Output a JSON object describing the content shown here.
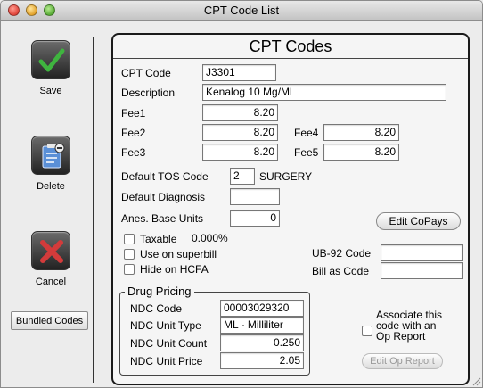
{
  "window": {
    "title": "CPT Code List"
  },
  "toolbar": {
    "save_label": "Save",
    "delete_label": "Delete",
    "cancel_label": "Cancel",
    "bundled_label": "Bundled Codes"
  },
  "panel": {
    "title": "CPT Codes"
  },
  "form": {
    "cpt_code_label": "CPT Code",
    "cpt_code": "J3301",
    "description_label": "Description",
    "description": "Kenalog 10 Mg/Ml",
    "fee1_label": "Fee1",
    "fee1": "8.20",
    "fee2_label": "Fee2",
    "fee2": "8.20",
    "fee3_label": "Fee3",
    "fee3": "8.20",
    "fee4_label": "Fee4",
    "fee4": "8.20",
    "fee5_label": "Fee5",
    "fee5": "8.20",
    "tos_label": "Default TOS Code",
    "tos_code": "2",
    "tos_name": "SURGERY",
    "diagnosis_label": "Default Diagnosis",
    "diagnosis": "",
    "anes_label": "Anes. Base Units",
    "anes_units": "0",
    "edit_copays_label": "Edit CoPays",
    "taxable_label": "Taxable",
    "tax_rate": "0.000%",
    "superbill_label": "Use on superbill",
    "hcfa_label": "Hide on HCFA",
    "ub92_label": "UB-92 Code",
    "ub92_code": "",
    "bill_as_label": "Bill as Code",
    "bill_as_code": ""
  },
  "drug": {
    "title": "Drug Pricing",
    "ndc_code_label": "NDC Code",
    "ndc_code": "00003029320",
    "ndc_unit_type_label": "NDC Unit Type",
    "ndc_unit_type": "ML - Milliliter",
    "ndc_unit_count_label": "NDC Unit Count",
    "ndc_unit_count": "0.250",
    "ndc_unit_price_label": "NDC Unit Price",
    "ndc_unit_price": "2.05"
  },
  "op_report": {
    "associate_line1": "Associate this",
    "associate_line2": "code with an",
    "associate_line3": "Op Report",
    "edit_label": "Edit Op Report"
  },
  "icons": {
    "save": "checkmark-icon",
    "delete": "clipboard-icon",
    "cancel": "x-icon"
  },
  "colors": {
    "check": "#3fb43f",
    "cross": "#d33b3b",
    "clipboard": "#5a8fd6"
  }
}
